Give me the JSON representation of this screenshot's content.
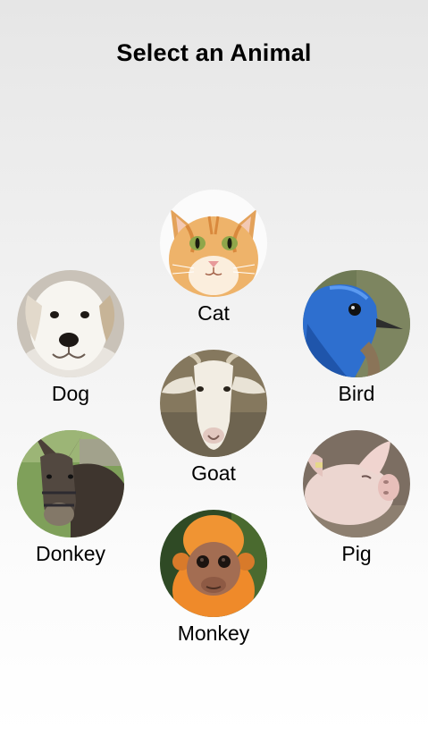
{
  "header": {
    "title": "Select an Animal"
  },
  "animals": [
    {
      "label": "Cat",
      "icon": "cat-photo"
    },
    {
      "label": "Dog",
      "icon": "dog-photo"
    },
    {
      "label": "Bird",
      "icon": "bird-photo"
    },
    {
      "label": "Goat",
      "icon": "goat-photo"
    },
    {
      "label": "Donkey",
      "icon": "donkey-photo"
    },
    {
      "label": "Pig",
      "icon": "pig-photo"
    },
    {
      "label": "Monkey",
      "icon": "monkey-photo"
    }
  ]
}
